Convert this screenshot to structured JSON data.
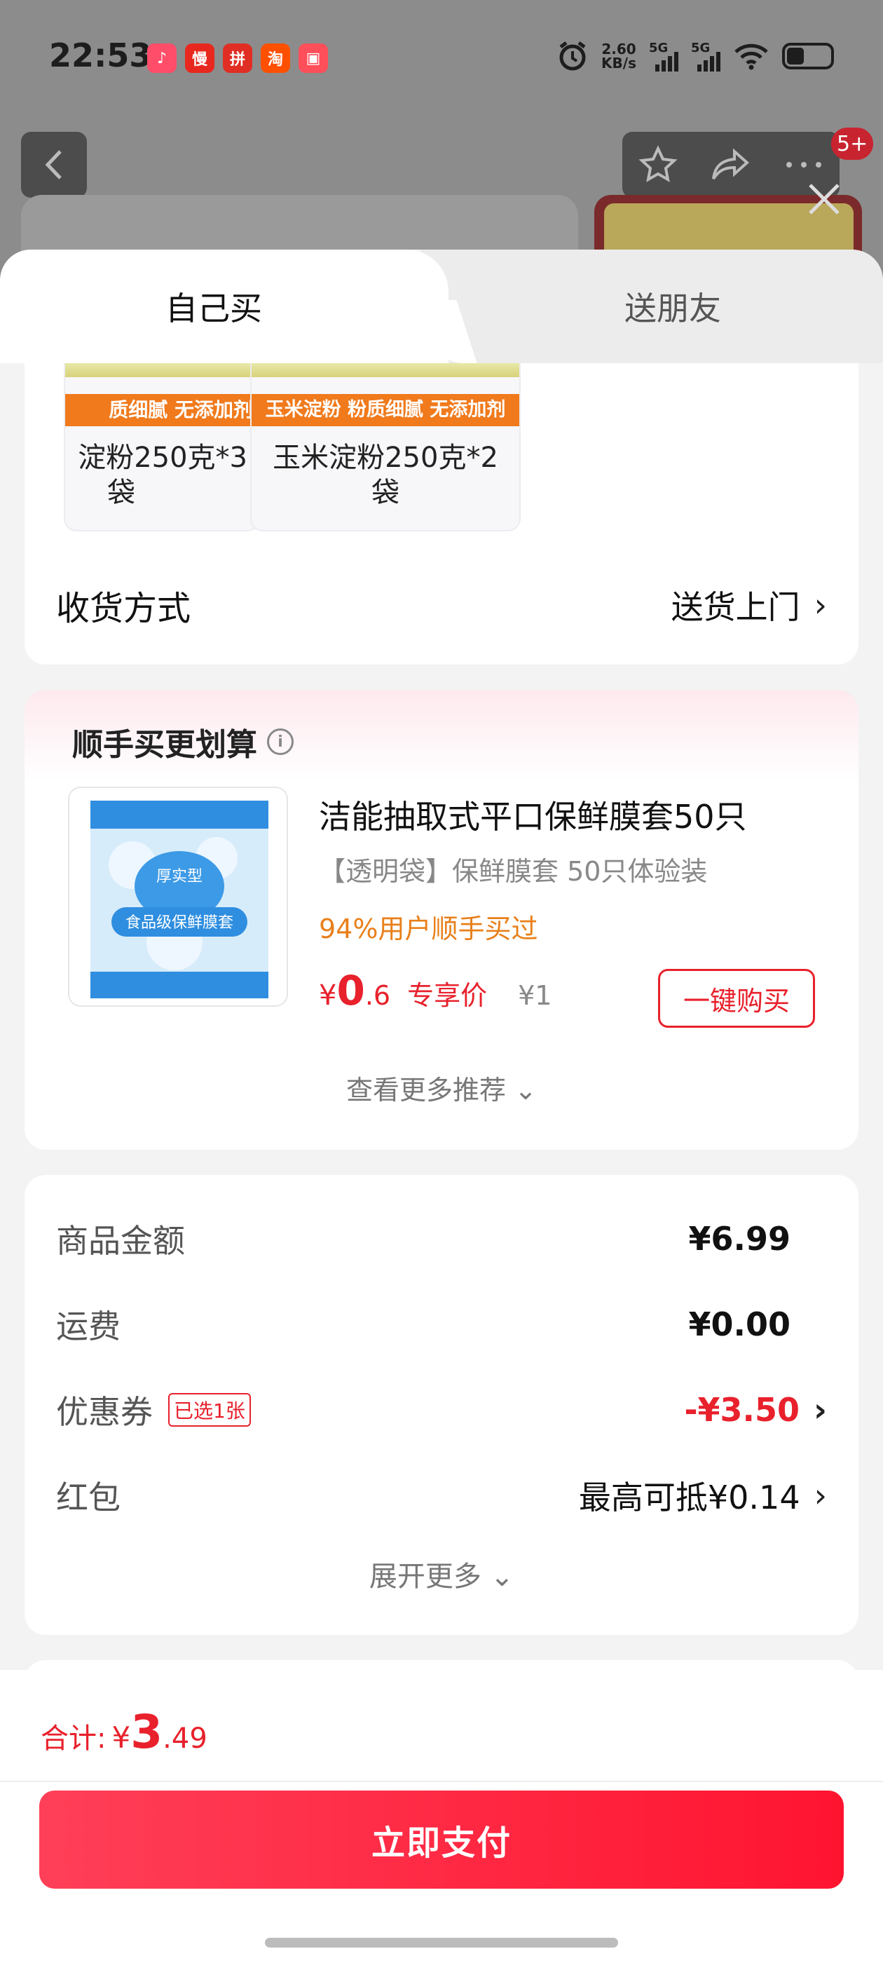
{
  "status_bar": {
    "time": "22:53",
    "app_icons": [
      {
        "icon": "douyin-app-icon",
        "color": "#ff4d6a",
        "glyph": "♪"
      },
      {
        "icon": "manmanbuy-app-icon",
        "color": "#e8281e",
        "glyph": "慢"
      },
      {
        "icon": "pinduoduo-app-icon",
        "color": "#e02e24",
        "glyph": "拼"
      },
      {
        "icon": "taobao-app-icon",
        "color": "#ff5000",
        "glyph": "淘"
      },
      {
        "icon": "storage-app-icon",
        "color": "#ff4f5a",
        "glyph": "▣"
      }
    ],
    "net_speed_value": "2.60",
    "net_speed_unit": "KB/s",
    "signal1_label": "5G",
    "signal2_label": "5G"
  },
  "background_page": {
    "badge": "5+"
  },
  "tabs": {
    "self": "自己买",
    "friend": "送朋友"
  },
  "variants": [
    {
      "banner": "质细腻 无添加剂",
      "name_line1": "淀粉250克*3",
      "name_line2": "袋"
    },
    {
      "banner": "玉米淀粉 粉质细腻 无添加剂",
      "name_line1": "玉米淀粉250克*2",
      "name_line2": "袋"
    }
  ],
  "delivery": {
    "label": "收货方式",
    "value": "送货上门"
  },
  "recommend": {
    "title": "顺手买更划算",
    "product_name": "洁能抽取式平口保鲜膜套50只",
    "product_spec": "【透明袋】保鲜膜套 50只体验装",
    "popularity": "94%用户顺手买过",
    "price_symbol": "¥",
    "price_int": "0",
    "price_dec": ".6",
    "price_tag": "专享价",
    "original_price": "¥1",
    "buy_button": "一键购买",
    "more": "查看更多推荐",
    "image_text": "食品级保鲜膜套",
    "image_brand": "厚实型"
  },
  "summary": {
    "goods_label": "商品金额",
    "goods_value": "¥6.99",
    "shipping_label": "运费",
    "shipping_value": "¥0.00",
    "coupon_label": "优惠券",
    "coupon_badge": "已选1张",
    "coupon_value": "-¥3.50",
    "redpacket_label": "红包",
    "redpacket_value": "最高可抵¥0.14",
    "expand": "展开更多"
  },
  "bottom": {
    "total_label": "合计:",
    "total_symbol": "¥",
    "total_int": "3",
    "total_dec": ".49",
    "pay_button": "立即支付"
  },
  "colors": {
    "accent_red": "#e8212c",
    "orange": "#e8801a",
    "pay_gradient_start": "#ff3f58",
    "pay_gradient_end": "#ff1430"
  }
}
